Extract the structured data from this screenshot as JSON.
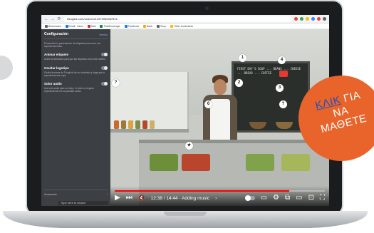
{
  "browser": {
    "url": "thinglink.com/video/1212379069387615",
    "nav": {
      "back": "←",
      "forward": "→",
      "reload": "⟳"
    },
    "bookmarks": [
      {
        "label": "Bookmarks",
        "color": "#5f6368"
      },
      {
        "label": "Email - Inbox",
        "color": "#1a73e8"
      },
      {
        "label": "Mail",
        "color": "#d93025"
      },
      {
        "label": "TheMessenger",
        "color": "#188038"
      },
      {
        "label": "Facebook",
        "color": "#1877f2"
      },
      {
        "label": "Bank",
        "color": "#f9ab00"
      },
      {
        "label": "Shop",
        "color": "#5f6368"
      },
      {
        "label": "Other bookmarks",
        "color": "#fbbc04"
      }
    ],
    "extension_colors": [
      "#ea4335",
      "#34a853",
      "#fbbc04",
      "#4285f4",
      "#ea4335",
      "#5f6368"
    ]
  },
  "sidebar": {
    "title": "Configuración",
    "done_label": "Hecho",
    "sections": [
      {
        "label": "",
        "desc": "Personalice la presentación de etiquetas para crear una experiencia única."
      },
      {
        "label": "Animar etiquete",
        "desc": "Active la animación para que las etiquetas sean más visibles."
      },
      {
        "label": "Ocultar logotipo",
        "desc": "Oculte la marca de ThingLink de su contenido y haga que la experiencia sea suya."
      },
      {
        "label": "Solor audio",
        "desc": "Use solo audio para su vídeo; el vídeo se seguirá reproduciendo con la pantalla oculta."
      }
    ],
    "footer_label": "Avanzado",
    "footer_arrow": "›"
  },
  "video": {
    "chalkboard_text": "FIRST DAY'S SOUP ... BEANS ... CHEESE ... BREAD ... COFFEE",
    "markers": [
      "1",
      "2",
      "3",
      "4",
      "5",
      "6",
      "?",
      "?",
      "★",
      "★"
    ],
    "progress": 0.83,
    "time": "12:38 / 14:44 · Adding music",
    "time_arrow": "›",
    "icons": {
      "play": "▶",
      "next": "⏭",
      "mute": "🔇",
      "subtitles": "▭",
      "settings": "⚙",
      "miniplayer": "⧉",
      "theater": "▭",
      "cast": "⊡",
      "fullscreen": "⛶"
    }
  },
  "taskbar": {
    "search_placeholder": "Type here to search"
  },
  "badge": {
    "link": "ΚΛΙΚ",
    "line1_rest": " ΓΙΑ",
    "line2": "ΝΑ",
    "line3": "ΜΑΘΕΤΕ",
    "color": "#e8642a",
    "link_color": "#1f4fbf"
  }
}
